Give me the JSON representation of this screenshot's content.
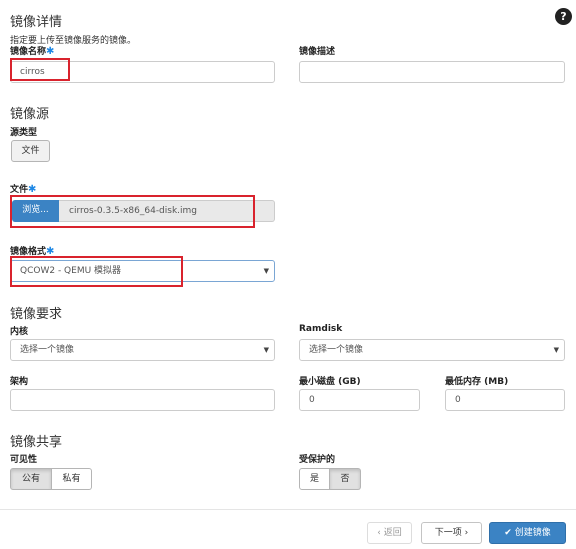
{
  "details": {
    "title": "镜像详情",
    "subtitle": "指定要上传至镜像服务的镜像。",
    "name_label": "镜像名称",
    "name_value": "cirros",
    "desc_label": "镜像描述",
    "desc_value": ""
  },
  "source": {
    "title": "镜像源",
    "type_label": "源类型",
    "type_button": "文件",
    "file_label": "文件",
    "browse_label": "浏览...",
    "file_name": "cirros-0.3.5-x86_64-disk.img",
    "format_label": "镜像格式",
    "format_value": "QCOW2 - QEMU 模拟器"
  },
  "requirements": {
    "title": "镜像要求",
    "kernel_label": "内核",
    "kernel_value": "选择一个镜像",
    "ramdisk_label": "Ramdisk",
    "ramdisk_value": "选择一个镜像",
    "arch_label": "架构",
    "arch_value": "",
    "min_disk_label": "最小磁盘 (GB)",
    "min_disk_value": "0",
    "min_ram_label": "最低内存 (MB)",
    "min_ram_value": "0"
  },
  "sharing": {
    "title": "镜像共享",
    "visibility_label": "可见性",
    "public_label": "公有",
    "private_label": "私有",
    "visibility_selected": "公有",
    "protected_label": "受保护的",
    "yes_label": "是",
    "no_label": "否",
    "protected_selected": "否"
  },
  "footer": {
    "back_label": "‹ 返回",
    "next_label": "下一项 ›",
    "create_label": "✔ 创建镜像"
  },
  "help_icon": "question-circle-icon",
  "required_mark": "✱",
  "caret": "▼",
  "colors": {
    "accent": "#3b83c4",
    "highlight": "#d9232d",
    "required": "#1e88e5"
  }
}
